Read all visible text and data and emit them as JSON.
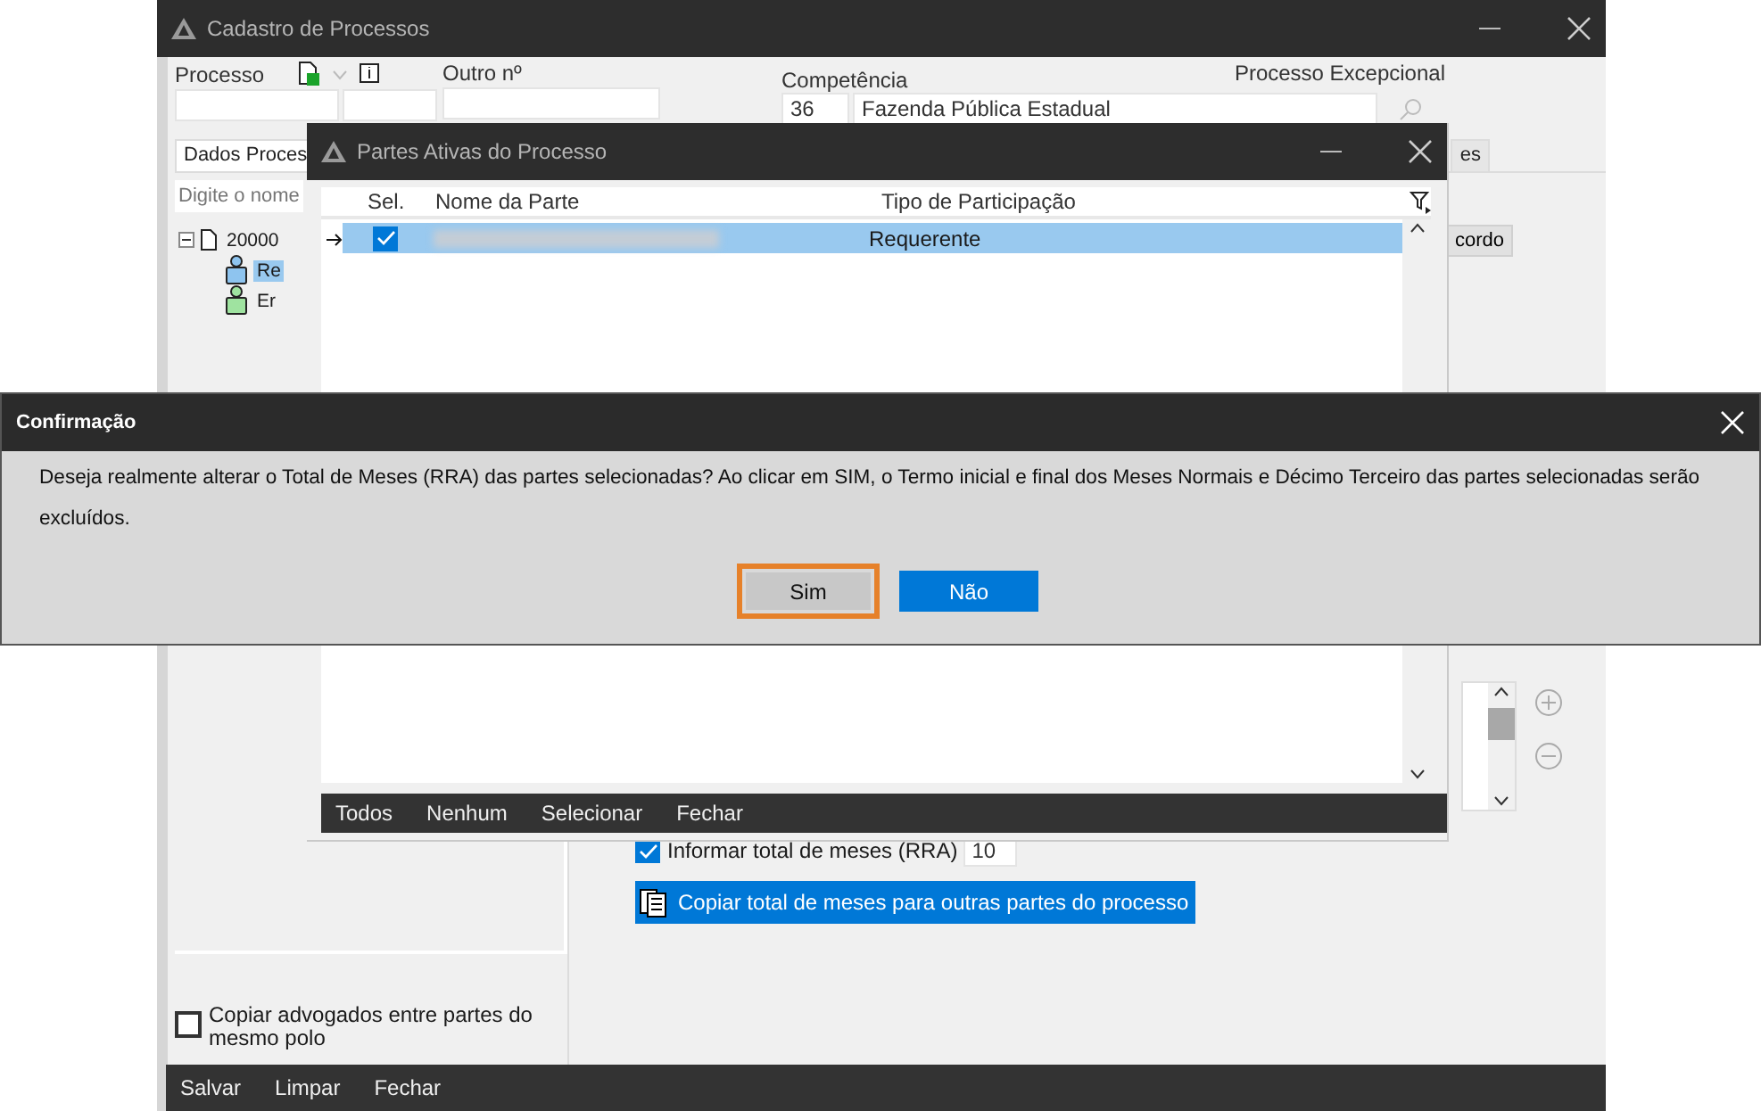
{
  "main_window": {
    "title": "Cadastro de Processos",
    "header": {
      "processo_label": "Processo",
      "outro_label": "Outro nº",
      "competencia_label": "Competência",
      "competencia_code": "36",
      "competencia_name": "Fazenda Pública Estadual",
      "excepcional_label": "Processo Excepcional"
    },
    "tabs": [
      {
        "label": "Dados Proces",
        "selected": true
      },
      {
        "label": "es",
        "selected": false
      }
    ],
    "search": {
      "placeholder": "Digite o nome"
    },
    "tree": [
      {
        "label": "20000",
        "expanded": true,
        "children": [
          {
            "label": "Re",
            "selected": true,
            "kind": "active"
          },
          {
            "label": "Er",
            "selected": false,
            "kind": "passive"
          }
        ]
      }
    ],
    "side_button": "cordo",
    "informar_rra": {
      "label": "Informar total de meses (RRA)",
      "checked": true,
      "value": "10"
    },
    "copy_button": "Copiar total de meses para outras partes do processo",
    "copy_lawyers": {
      "label": "Copiar advogados entre partes do mesmo polo",
      "checked": false
    },
    "footer": [
      "Salvar",
      "Limpar",
      "Fechar"
    ]
  },
  "parties_dialog": {
    "title": "Partes Ativas do Processo",
    "columns": [
      "Sel.",
      "Nome da Parte",
      "Tipo de Participação"
    ],
    "rows": [
      {
        "current": true,
        "checked": true,
        "selected": true,
        "type": "Requerente"
      }
    ],
    "footer": [
      "Todos",
      "Nenhum",
      "Selecionar",
      "Fechar"
    ]
  },
  "confirm_dialog": {
    "title": "Confirmação",
    "message": "Deseja realmente alterar o Total de Meses (RRA) das partes selecionadas? Ao clicar em SIM, o Termo inicial e final dos Meses Normais e Décimo Terceiro das partes selecionadas serão excluídos.",
    "buttons": [
      {
        "label": "Sim",
        "kind": "secondary",
        "focused": true
      },
      {
        "label": "Não",
        "kind": "primary",
        "focused": false
      }
    ]
  }
}
